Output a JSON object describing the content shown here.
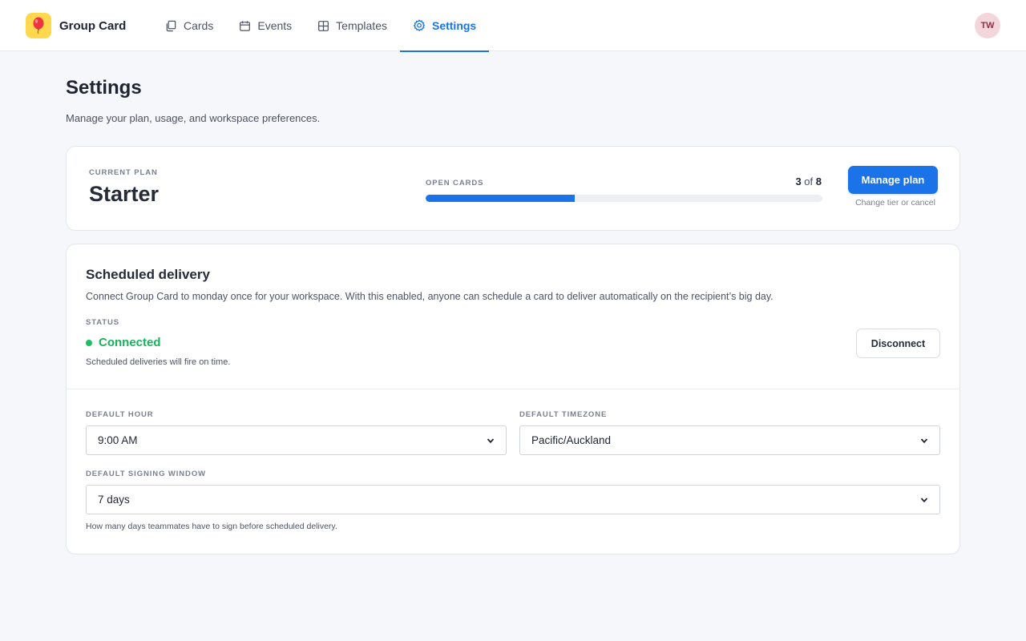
{
  "app": {
    "name": "Group Card"
  },
  "nav": {
    "items": [
      {
        "label": "Cards",
        "icon": "cards-icon"
      },
      {
        "label": "Events",
        "icon": "calendar-icon"
      },
      {
        "label": "Templates",
        "icon": "grid-icon"
      },
      {
        "label": "Settings",
        "icon": "gear-icon",
        "active": true
      }
    ]
  },
  "user": {
    "initials": "TW"
  },
  "page": {
    "title": "Settings",
    "subtitle": "Manage your plan, usage, and workspace preferences."
  },
  "plan": {
    "label": "CURRENT PLAN",
    "name": "Starter",
    "usage_label": "OPEN CARDS",
    "used": "3",
    "of_text": "of",
    "limit": "8",
    "progress_fraction": 0.375,
    "manage_button": "Manage plan",
    "manage_hint": "Change tier or cancel"
  },
  "delivery": {
    "title": "Scheduled delivery",
    "description": "Connect Group Card to monday once for your workspace. With this enabled, anyone can schedule a card to deliver automatically on the recipient’s big day.",
    "status_label": "STATUS",
    "status": "Connected",
    "status_note": "Scheduled deliveries will fire on time.",
    "disconnect_button": "Disconnect",
    "default_hour_label": "DEFAULT HOUR",
    "default_hour": "9:00 AM",
    "default_timezone_label": "DEFAULT TIMEZONE",
    "default_timezone": "Pacific/Auckland",
    "signing_window_label": "DEFAULT SIGNING WINDOW",
    "signing_window": "7 days",
    "signing_window_hint": "How many days teammates have to sign before scheduled delivery."
  },
  "colors": {
    "accent": "#1a73e8",
    "success": "#17b35a",
    "logo_bg": "#ffd84d"
  }
}
